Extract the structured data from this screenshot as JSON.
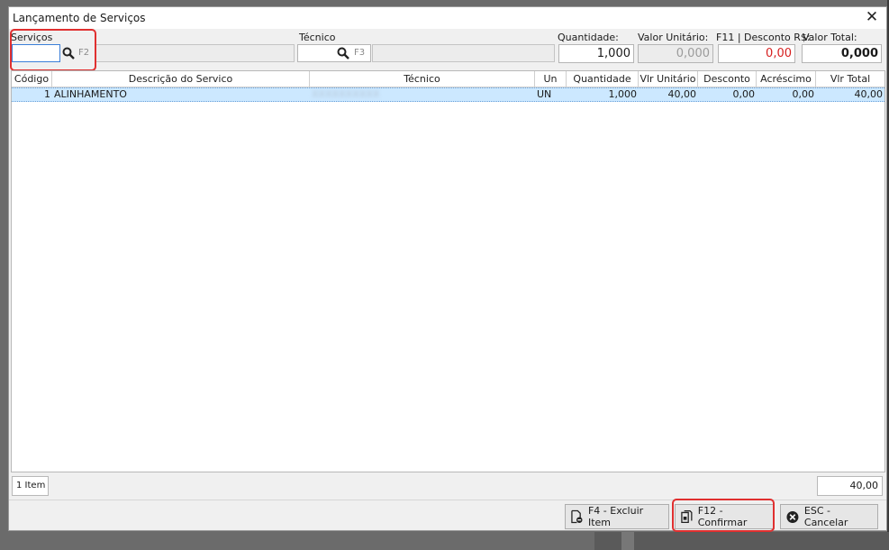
{
  "window": {
    "title": "Lançamento de Serviços",
    "close_glyph": "✕"
  },
  "form": {
    "servicos_label": "Serviços",
    "servicos_hotkey": "F2",
    "tecnico_label": "Técnico",
    "tecnico_hotkey": "F3",
    "quantidade_label": "Quantidade:",
    "quantidade_value": "1,000",
    "valor_unitario_label": "Valor Unitário:",
    "valor_unitario_value": "0,000",
    "desconto_label": "F11 | Desconto R$:",
    "desconto_value": "0,00",
    "valor_total_label": "Valor Total:",
    "valor_total_value": "0,000"
  },
  "grid": {
    "columns": [
      "Código",
      "Descrição do Servico",
      "Técnico",
      "Un",
      "Quantidade",
      "Vlr Unitário",
      "Desconto",
      "Acréscimo",
      "Vlr Total"
    ],
    "rows": [
      {
        "codigo": "1",
        "descricao": "ALINHAMENTO",
        "tecnico": "XXXXXXXXXX",
        "un": "UN",
        "quantidade": "1,000",
        "vlr_unitario": "40,00",
        "desconto": "0,00",
        "acrescimo": "0,00",
        "vlr_total": "40,00"
      }
    ]
  },
  "footer": {
    "item_count": "1 Item",
    "total": "40,00"
  },
  "buttons": {
    "excluir": "F4 - Excluir Item",
    "confirmar": "F12 - Confirmar",
    "cancelar": "ESC - Cancelar"
  },
  "colors": {
    "highlight": "#e03030",
    "selected_row": "#cce8ff",
    "discount_red": "#d62020"
  },
  "icons": [
    "close-icon",
    "search-icon",
    "delete-doc-icon",
    "confirm-doc-icon",
    "cancel-circle-icon"
  ]
}
